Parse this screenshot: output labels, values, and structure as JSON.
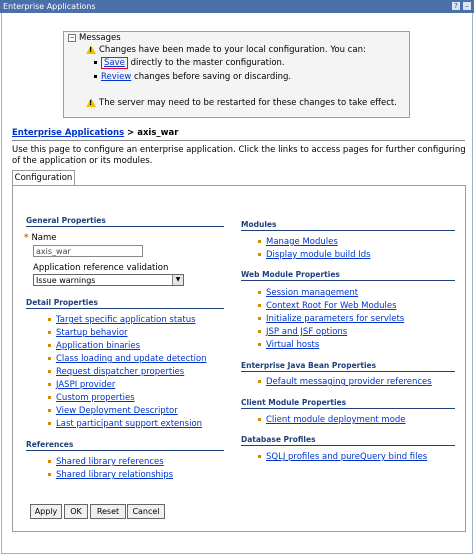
{
  "window": {
    "title": "Enterprise Applications",
    "help": "?",
    "minimize": "–"
  },
  "messages": {
    "header": "Messages",
    "line1": "Changes have been made to your local configuration. You can:",
    "save_link": "Save",
    "save_rest": "directly to the master configuration.",
    "review_link": "Review",
    "review_rest": "changes before saving or discarding.",
    "restart": "The server may need to be restarted for these changes to take effect."
  },
  "breadcrumb": {
    "link": "Enterprise Applications",
    "sep": ">",
    "current": "axis_war"
  },
  "description": "Use this page to configure an enterprise application. Click the links to access pages for further configuring of the application or its modules.",
  "tab": "Configuration",
  "general": {
    "title": "General Properties",
    "name_label": "Name",
    "name_value": "axis_war",
    "arv_label": "Application reference validation",
    "arv_value": "Issue warnings"
  },
  "detail": {
    "title": "Detail Properties",
    "items": [
      "Target specific application status",
      "Startup behavior",
      "Application binaries",
      "Class loading and update detection",
      "Request dispatcher properties",
      "JASPI provider",
      "Custom properties",
      "View Deployment Descriptor",
      "Last participant support extension"
    ]
  },
  "references": {
    "title": "References",
    "items": [
      "Shared library references",
      "Shared library relationships"
    ]
  },
  "modules": {
    "title": "Modules",
    "items": [
      "Manage Modules",
      "Display module build Ids"
    ]
  },
  "web_module": {
    "title": "Web Module Properties",
    "items": [
      "Session management",
      "Context Root For Web Modules",
      "Initialize parameters for servlets",
      "JSP and JSF options",
      "Virtual hosts"
    ]
  },
  "ejb": {
    "title": "Enterprise Java Bean Properties",
    "items": [
      "Default messaging provider references"
    ]
  },
  "client": {
    "title": "Client Module Properties",
    "items": [
      "Client module deployment mode"
    ]
  },
  "db": {
    "title": "Database Profiles",
    "items": [
      "SQLJ profiles and pureQuery bind files"
    ]
  },
  "buttons": {
    "apply": "Apply",
    "ok": "OK",
    "reset": "Reset",
    "cancel": "Cancel"
  }
}
